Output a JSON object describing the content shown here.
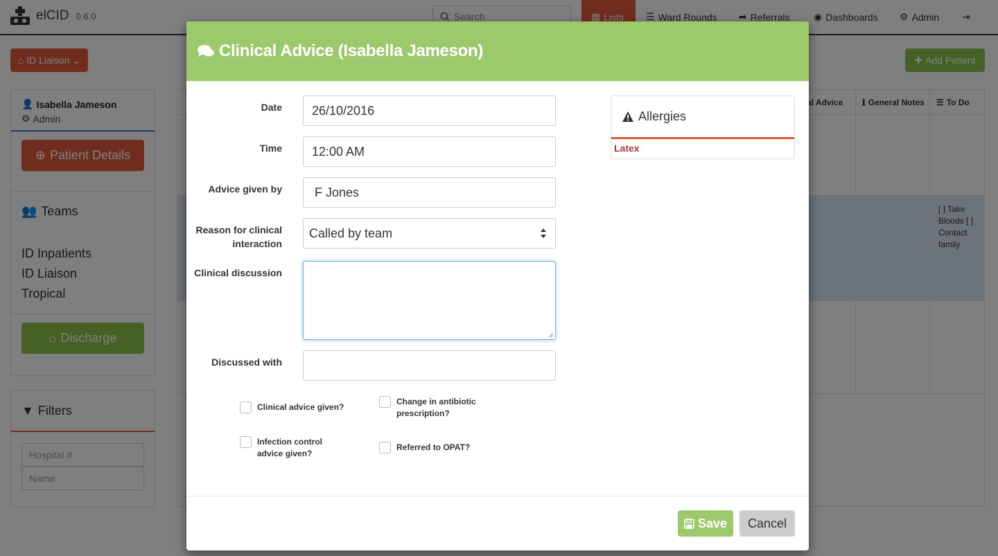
{
  "app": {
    "name": "elCID",
    "version": "0.6.0"
  },
  "nav": {
    "search_placeholder": "Search",
    "items": [
      {
        "label": "Lists",
        "icon": "table-icon",
        "active": true
      },
      {
        "label": "Ward Rounds",
        "icon": "list-icon"
      },
      {
        "label": "Referrals",
        "icon": "share-icon"
      },
      {
        "label": "Dashboards",
        "icon": "dashboard-icon"
      },
      {
        "label": "Admin",
        "icon": "cogs-icon"
      }
    ]
  },
  "page": {
    "list_selector_label": "ID Liaison",
    "add_patient_label": "Add Patient"
  },
  "sidebar": {
    "user_name": "Isabella Jameson",
    "user_role": "Admin",
    "patient_details_label": "Patient Details",
    "teams_heading": "Teams",
    "teams": [
      "ID Inpatients",
      "ID Liaison",
      "Tropical"
    ],
    "discharge_label": "Discharge",
    "filters_heading": "Filters",
    "filter_hospital_placeholder": "Hospital #",
    "filter_name_placeholder": "Name"
  },
  "table": {
    "headers": [
      "ical Advice",
      "General Notes",
      "To Do"
    ],
    "todo_text": "[ ] Take Bloods [ ] Contact family"
  },
  "modal": {
    "title": "Clinical Advice (Isabella Jameson)",
    "fields": {
      "date_label": "Date",
      "date_value": "26/10/2016",
      "time_label": "Time",
      "time_value": "12:00 AM",
      "advice_given_by_label": "Advice given by",
      "advice_given_by_value": "F Jones",
      "reason_label": "Reason for clinical interaction",
      "reason_value": "Called by team",
      "discussion_label": "Clinical discussion",
      "discussion_value": "",
      "discussed_with_label": "Discussed with",
      "discussed_with_value": ""
    },
    "checkboxes": {
      "clinical_advice_given": "Clinical advice given?",
      "infection_control_advice": "Infection control advice given?",
      "change_in_antibiotic": "Change in antibiotic prescription?",
      "referred_to_opat": "Referred to OPAT?"
    },
    "allergies": {
      "heading": "Allergies",
      "items": [
        "Latex"
      ]
    },
    "save_label": "Save",
    "cancel_label": "Cancel"
  },
  "colors": {
    "header_green": "#9cc96b",
    "accent_red": "#e05a3a",
    "allergy_text": "#a03a3a"
  }
}
